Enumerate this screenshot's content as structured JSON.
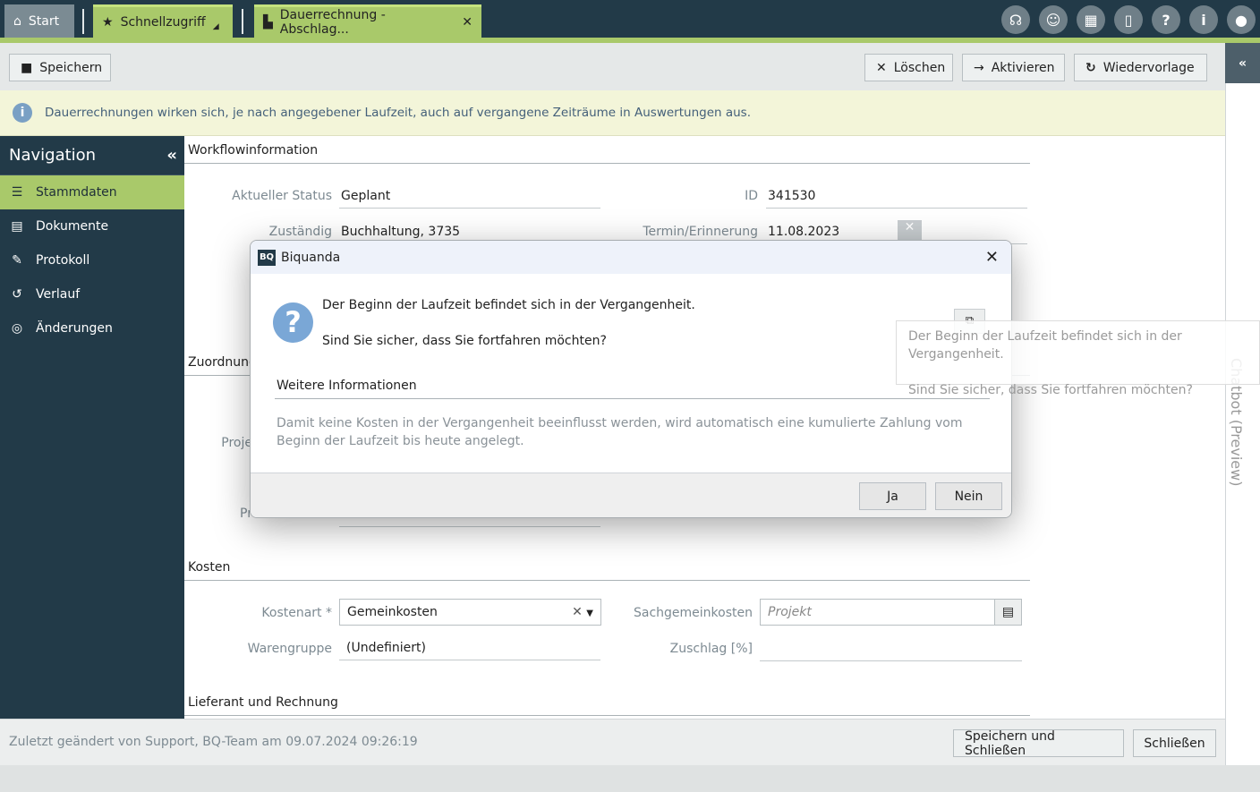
{
  "tabs": {
    "start": "Start",
    "quick": "Schnellzugriff",
    "doc": "Dauerrechnung - Abschlag..."
  },
  "topicons": [
    "headset-icon",
    "smiley-icon",
    "gift-icon",
    "phone-icon",
    "help-icon",
    "info-icon",
    "user-icon"
  ],
  "toolbar": {
    "save": "Speichern",
    "delete": "Löschen",
    "activate": "Aktivieren",
    "resubmit": "Wiedervorlage"
  },
  "info": "Dauerrechnungen wirken sich, je nach angegebener Laufzeit, auch auf vergangene Zeiträume in Auswertungen aus.",
  "nav": {
    "title": "Navigation",
    "items": [
      "Stammdaten",
      "Dokumente",
      "Protokoll",
      "Verlauf",
      "Änderungen"
    ]
  },
  "chatbot": "Chatbot (Preview)",
  "form": {
    "sec_workflow": "Workflowinformation",
    "status_label": "Aktueller Status",
    "status": "Geplant",
    "id_label": "ID",
    "id": "341530",
    "resp_label": "Zuständig",
    "resp": "Buchhaltung, 3735",
    "date_label": "Termin/Erinnerung",
    "date": "11.08.2023",
    "sec_assign": "Zuordnung",
    "proj_label_partial": "Proje",
    "pr_partial": "Pr",
    "sec_cost": "Kosten",
    "costtype_label": "Kostenart *",
    "costtype": "Gemeinkosten",
    "sgk_label": "Sachgemeinkosten",
    "sgk_placeholder": "Projekt",
    "group_label": "Warengruppe",
    "group": "(Undefiniert)",
    "surcharge_label": "Zuschlag [%]",
    "sec_supplier": "Lieferant und Rechnung"
  },
  "footer": {
    "changed": "Zuletzt geändert von Support, BQ-Team am 09.07.2024 09:26:19",
    "save_close": "Speichern und Schließen",
    "close": "Schließen"
  },
  "dialog": {
    "title": "Biquanda",
    "logo": "BQ",
    "msg1": "Der Beginn der Laufzeit befindet sich in der Vergangenheit.",
    "msg2": "Sind Sie sicher, dass Sie fortfahren möchten?",
    "more": "Weitere Informationen",
    "detail": "Damit keine Kosten in der Vergangenheit beeinflusst werden, wird automatisch eine kumulierte Zahlung vom Beginn der Laufzeit bis heute angelegt.",
    "yes": "Ja",
    "no": "Nein"
  },
  "tooltip": {
    "line1": "Der Beginn der Laufzeit befindet sich in der Vergangenheit.",
    "line2": "Sind Sie sicher, dass Sie fortfahren möchten?"
  }
}
